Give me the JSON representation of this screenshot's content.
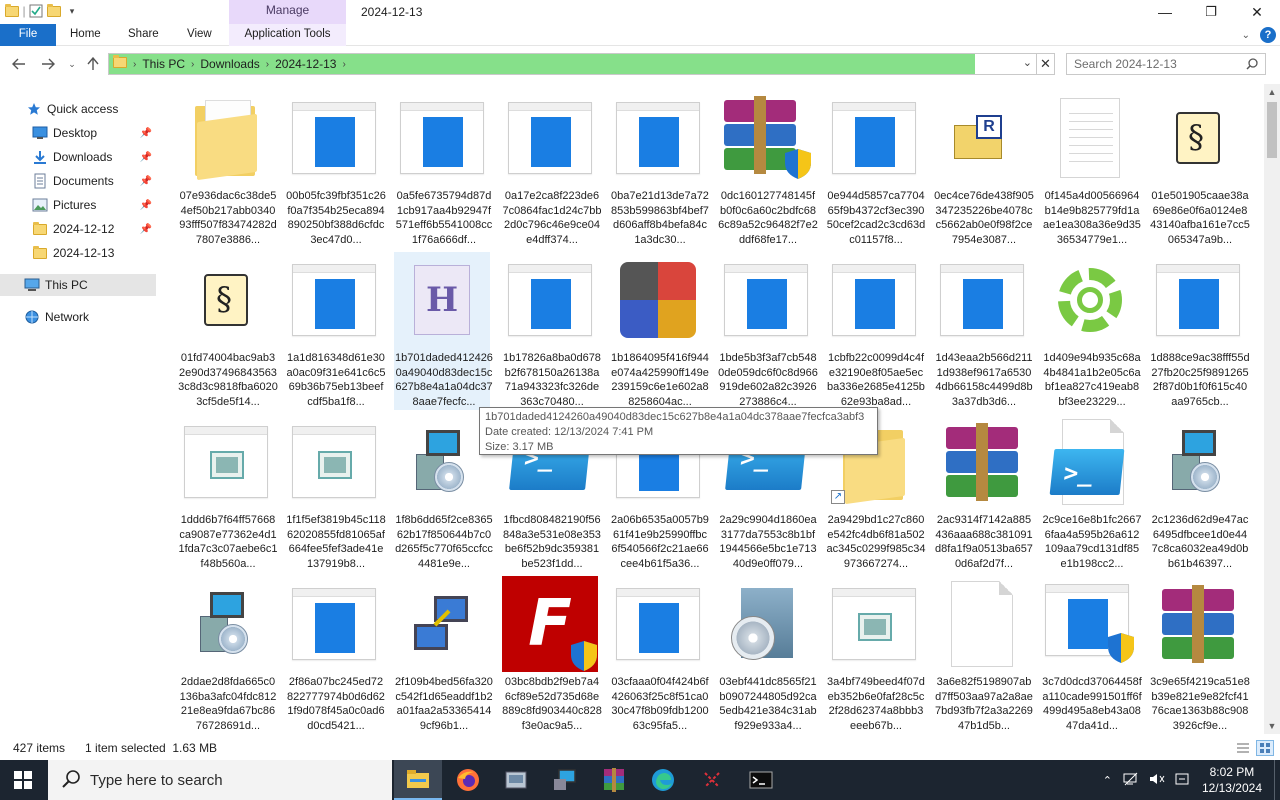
{
  "titlebar": {
    "manage_label": "Manage",
    "title": "2024-12-13",
    "minimize": "—",
    "maximize": "❐",
    "close": "✕"
  },
  "ribbon": {
    "tabs": [
      "File",
      "Home",
      "Share",
      "View",
      "Application Tools"
    ],
    "help": "?"
  },
  "address": {
    "crumbs": [
      "This PC",
      "Downloads",
      "2024-12-13"
    ],
    "search_placeholder": "Search 2024-12-13"
  },
  "sidebar": {
    "items": [
      {
        "label": "Quick access",
        "icon": "star-icon"
      },
      {
        "label": "Desktop",
        "icon": "desktop-icon",
        "pinned": true
      },
      {
        "label": "Downloads",
        "icon": "download-icon",
        "pinned": true
      },
      {
        "label": "Documents",
        "icon": "documents-icon",
        "pinned": true
      },
      {
        "label": "Pictures",
        "icon": "pictures-icon",
        "pinned": true
      },
      {
        "label": "2024-12-12",
        "icon": "folder-icon",
        "pinned": true
      },
      {
        "label": "2024-12-13",
        "icon": "folder-icon"
      },
      {
        "label": "This PC",
        "icon": "computer-icon"
      },
      {
        "label": "Network",
        "icon": "network-icon"
      }
    ]
  },
  "files": [
    {
      "name": "07e936dac6c38de54ef50b217abb034093fff507f83474282d7807e3886...",
      "icon": "folder"
    },
    {
      "name": "00b05fc39fbf351c26f0a7f354b25eca894890250bf388d6cfdc3ec47d0...",
      "icon": "doc-blue"
    },
    {
      "name": "0a5fe6735794d87d1cb917aa4b92947f571eff6b5541008cc1f76a666df...",
      "icon": "doc-blue"
    },
    {
      "name": "0a17e2ca8f223de67c0864fac1d24c7bb2d0c796c46e9ce04e4dff374...",
      "icon": "doc-blue"
    },
    {
      "name": "0ba7e21d13de7a72853b599863bf4bef7d606aff8b4befa84c1a3dc30...",
      "icon": "doc-blue"
    },
    {
      "name": "0dc160127748145fb0f0c6a60c2bdfc686c89a52c96482f7e2ddf68fe17...",
      "icon": "rar-shield"
    },
    {
      "name": "0e944d5857ca770465f9b4372cf3ec39050cef2cad2c3cd63dc01157f8...",
      "icon": "doc-blue"
    },
    {
      "name": "0ec4ce76de438f905347235226be407​8cc5662ab0e0f98f2ce7954e3087...",
      "icon": "registry"
    },
    {
      "name": "0f145a4d00566964b14e9b825779fd1aae1ea308a36e9d3536534779e1...",
      "icon": "lines-page"
    },
    {
      "name": "01e501905caae38a69e86e0f6a0124e843140afba161e7cc5065347a9b...",
      "icon": "script"
    },
    {
      "name": "01fd74004bac9ab32e90d374968435633c8d3c9818fba60203cf5de5f14...",
      "icon": "script"
    },
    {
      "name": "1a1d816348d61e30a0ac09f31e641c6c569b36b75eb13beefcdf5ba1f8...",
      "icon": "doc-blue"
    },
    {
      "name": "1b701daded4124260a49040d83dec15c627b8e4a1a04dc378aae7fecfc...",
      "icon": "h-file"
    },
    {
      "name": "1b17826a8ba0d678b2f678150a26138a71a943323fc326de363c70480...",
      "icon": "doc-blue"
    },
    {
      "name": "1b1864095f416f944e074a425990ff149e239159c6e1e602a88258604ac...",
      "icon": "mosaic"
    },
    {
      "name": "1bde5b3f3af7cb5480de059dc6f0c8d966919de602a82c3926273886c4...",
      "icon": "doc-blue"
    },
    {
      "name": "1cbfb22c0099d4c4fe32190e8f05ae5ecba336e2685e4125b62e93ba8ad...",
      "icon": "doc-blue"
    },
    {
      "name": "1d43eaa2b566d2111d938ef9617a65304db66158c4499d8b3a37db3d6...",
      "icon": "doc-blue"
    },
    {
      "name": "1d409e94b935c68a4b4841a1b2e05c6abf1ea827c419eab8bf3ee23229...",
      "icon": "gear"
    },
    {
      "name": "1d888ce9ac38fff55d27fb20c25f98912652f87d0b1f0f615c40aa9765cb...",
      "icon": "doc-blue"
    },
    {
      "name": "1ddd6b7f64ff57668ca9087e77362e4d11fda7c3c07aebe6c1f48b560a...",
      "icon": "doc-green"
    },
    {
      "name": "1f1f5ef3819b45c11862020855fd81065af664fee5fef3ade41e137919b8...",
      "icon": "doc-green"
    },
    {
      "name": "1f8b6dd65f2ce836562b17f850644b7c0d265f5c770f65ccfcc4481e9e...",
      "icon": "setup"
    },
    {
      "name": "1fbcd808482190f56848a3e531e08e353be6f52b9dc359381be523f1dd...",
      "icon": "powershell"
    },
    {
      "name": "2a06b6535a0057b961f41e9b25990ffbc6f540566f2c21ae66cee4b61f5a36...",
      "icon": "doc-blue"
    },
    {
      "name": "2a29c9904d1860ea3177da7553c8b1bf1944566e5bc1e71340d9e0ff079...",
      "icon": "powershell"
    },
    {
      "name": "2a9429bd1c27c860e542fc4db6f81a502ac345c0299f985c34973667274...",
      "icon": "folder-shortcut"
    },
    {
      "name": "2ac9314f7142a885436aaa688c381091d8fa1f9a0513ba6570d6af2d7f...",
      "icon": "rar"
    },
    {
      "name": "2c9ce16e8b1fc26676faa4a595b26a612109aa79cd131df85e1b198cc2...",
      "icon": "powershell-page"
    },
    {
      "name": "2c1236d62d9e47ac6495dfbcee1d0e447c8ca6032ea49d0bb61b46397...",
      "icon": "setup"
    },
    {
      "name": "2ddae2d8fda665c0136ba3afc04fdc81221e8ea9fda67bc8676728691d...",
      "icon": "setup"
    },
    {
      "name": "2f86a07bc245ed72822777974b0d6d621f9d078f45a0c0ad6d0cd5421...",
      "icon": "doc-blue"
    },
    {
      "name": "2f109b4bed56fa320c542f1d65eaddf1b2a01faa2a533654149cf96b1...",
      "icon": "network-app"
    },
    {
      "name": "03bc8bdb2f9eb7a46cf89e52d735d68e889c8fd903440c828f3e0ac9a5...",
      "icon": "filezilla"
    },
    {
      "name": "03cfaaa0f04f424b6f426063f25c8f51ca030c47f8b09fdb120063c95fa5...",
      "icon": "doc-blue"
    },
    {
      "name": "03ebf441dc8565f21b0907244805d92ca5edb421e384c31abf929e933a4...",
      "icon": "cd-box"
    },
    {
      "name": "3a4bf749beed4f07deb352b6e0faf28c5c2f28d62374a8bbb3eeeb67b...",
      "icon": "doc-green"
    },
    {
      "name": "3a6e82f5198907abd7ff503aa97a2a8ae7bd93fb7f2a3a226947b1d5b...",
      "icon": "blank"
    },
    {
      "name": "3c7d0dcd37064458fa110cade991501ff6f499d495a8eb43a0847da41d...",
      "icon": "doc-blue-shield"
    },
    {
      "name": "3c9e65f4219ca51e8b39e821e9e82fcf4176cae1363b88c9083926cf9e...",
      "icon": "rar"
    }
  ],
  "tooltip": {
    "line1": "1b701daded4124260a49040d83dec15c627b8e4a1a04dc378aae7fecfca3abf3",
    "line2": "Date created: 12/13/2024 7:41 PM",
    "line3": "Size: 3.17 MB"
  },
  "status": {
    "count": "427 items",
    "selection": "1 item selected  1.63 MB"
  },
  "taskbar": {
    "search_placeholder": "Type here to search",
    "time": "8:02 PM",
    "date": "12/13/2024"
  },
  "colors": {
    "accent": "#1a6fc9",
    "address_fill": "#86e08a",
    "manage": "#e8d9fa",
    "taskbar": "#1c2530"
  }
}
